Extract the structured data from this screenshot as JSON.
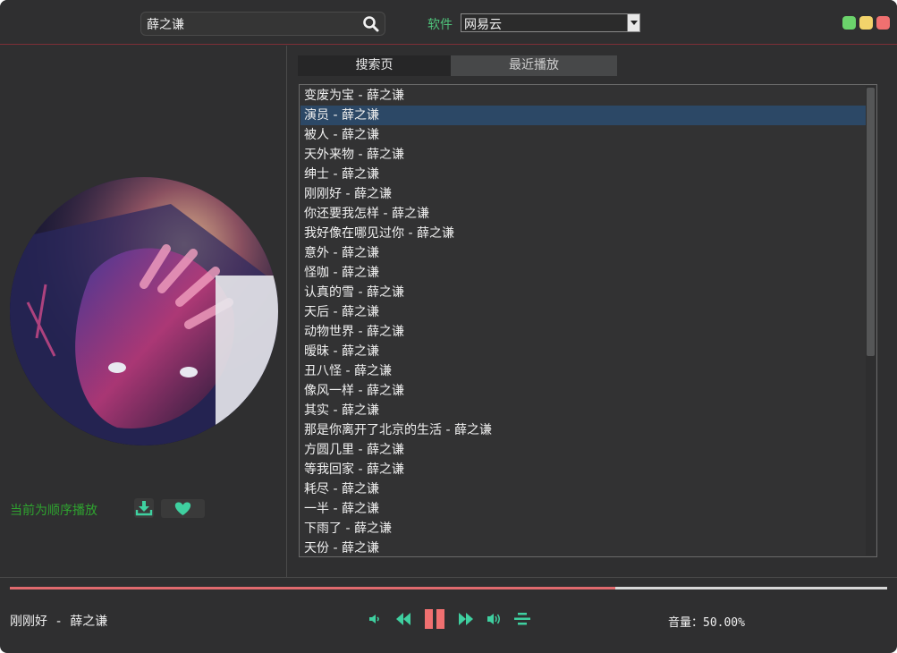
{
  "search": {
    "value": "薛之谦"
  },
  "source": {
    "label": "软件",
    "selected": "网易云"
  },
  "tabs": [
    {
      "label": "搜索页"
    },
    {
      "label": "最近播放"
    }
  ],
  "songs": [
    "变废为宝 - 薛之谦",
    "演员 - 薛之谦",
    "被人 - 薛之谦",
    "天外来物 - 薛之谦",
    "绅士 - 薛之谦",
    "刚刚好 - 薛之谦",
    "你还要我怎样 - 薛之谦",
    "我好像在哪见过你 - 薛之谦",
    "意外 - 薛之谦",
    "怪咖 - 薛之谦",
    "认真的雪 - 薛之谦",
    "天后 - 薛之谦",
    "动物世界 - 薛之谦",
    "暧昧 - 薛之谦",
    "丑八怪 - 薛之谦",
    "像风一样 - 薛之谦",
    "其实 - 薛之谦",
    "那是你离开了北京的生活 - 薛之谦",
    "方圆几里 - 薛之谦",
    "等我回家 - 薛之谦",
    "耗尽 - 薛之谦",
    "一半 - 薛之谦",
    "下雨了 - 薛之谦",
    "天份 - 薛之谦"
  ],
  "selected_index": 1,
  "player": {
    "play_mode": "当前为顺序播放",
    "now_playing": "刚刚好 - 薛之谦",
    "progress": 0.69,
    "volume_label": "音量：50.00%"
  },
  "colors": {
    "accent": "#4fc27a",
    "progress": "#e06a6e",
    "selection": "#2c4866",
    "pause": "#f07070"
  },
  "icons": [
    "search-icon",
    "download-icon",
    "heart-icon",
    "volume-down-icon",
    "previous-icon",
    "pause-icon",
    "next-icon",
    "volume-up-icon",
    "playlist-mode-icon"
  ]
}
